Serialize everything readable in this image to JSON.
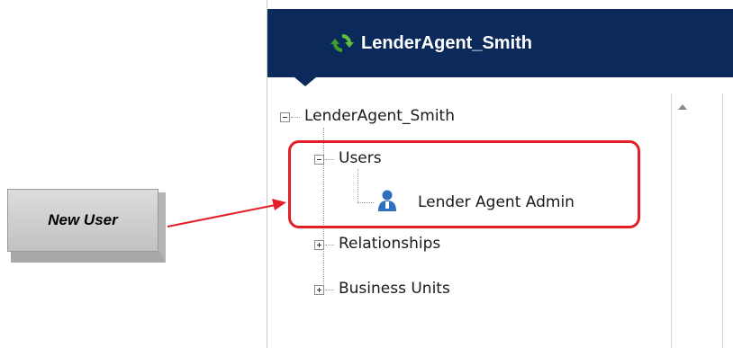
{
  "callout": {
    "label": "New User"
  },
  "header": {
    "title": "LenderAgent_Smith",
    "icon": "refresh-icon"
  },
  "tree": {
    "root": {
      "label": "LenderAgent_Smith",
      "expanded": true
    },
    "users": {
      "label": "Users",
      "expanded": true
    },
    "user_item": {
      "label": "Lender Agent Admin",
      "icon": "user-icon"
    },
    "relationships": {
      "label": "Relationships",
      "expanded": false
    },
    "business_units": {
      "label": "Business Units",
      "expanded": false
    }
  },
  "colors": {
    "header_bg": "#0b2a5b",
    "highlight": "#e41e26",
    "callout_bg": "#d0d0d0"
  }
}
